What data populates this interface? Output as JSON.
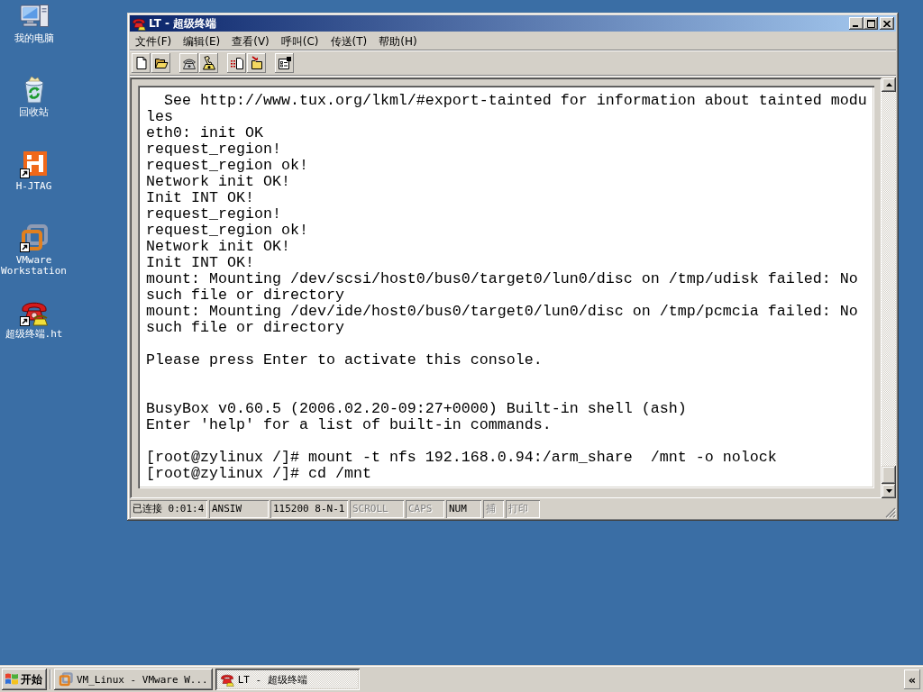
{
  "desktop": {
    "icons": [
      {
        "label": "我的电脑",
        "kind": "computer",
        "shortcut": false
      },
      {
        "label": "回收站",
        "kind": "recycle-bin",
        "shortcut": false
      },
      {
        "label": "H-JTAG",
        "kind": "h-jtag",
        "shortcut": true
      },
      {
        "label": "VMware Workstation",
        "kind": "vmware",
        "shortcut": true
      },
      {
        "label": "超级终端.ht",
        "kind": "phone",
        "shortcut": true
      }
    ]
  },
  "window": {
    "title": "LT - 超级终端",
    "active": true,
    "menu": [
      "文件(F)",
      "编辑(E)",
      "查看(V)",
      "呼叫(C)",
      "传送(T)",
      "帮助(H)"
    ],
    "toolbar": {
      "groups": [
        {
          "buttons": [
            {
              "kind": "new",
              "disabled": false
            },
            {
              "kind": "open",
              "disabled": false
            }
          ]
        },
        {
          "buttons": [
            {
              "kind": "call",
              "disabled": true
            },
            {
              "kind": "disconnect",
              "disabled": false
            }
          ]
        },
        {
          "buttons": [
            {
              "kind": "send",
              "disabled": false
            },
            {
              "kind": "receive",
              "disabled": false
            }
          ]
        },
        {
          "buttons": [
            {
              "kind": "properties",
              "disabled": false
            }
          ]
        }
      ]
    },
    "terminal": {
      "lines": [
        {
          "kind": "text",
          "text": "  See http://www.tux.org/lkml/#export-tainted for information about tainted modu"
        },
        {
          "kind": "text",
          "text": "les"
        },
        {
          "kind": "text",
          "text": "eth0: init OK"
        },
        {
          "kind": "text",
          "text": "request_region!"
        },
        {
          "kind": "text",
          "text": "request_region ok!"
        },
        {
          "kind": "text",
          "text": "Network init OK!"
        },
        {
          "kind": "text",
          "text": "Init INT OK!"
        },
        {
          "kind": "text",
          "text": "request_region!"
        },
        {
          "kind": "text",
          "text": "request_region ok!"
        },
        {
          "kind": "text",
          "text": "Network init OK!"
        },
        {
          "kind": "text",
          "text": "Init INT OK!"
        },
        {
          "kind": "text",
          "text": "mount: Mounting /dev/scsi/host0/bus0/target0/lun0/disc on /tmp/udisk failed: No"
        },
        {
          "kind": "text",
          "text": "such file or directory"
        },
        {
          "kind": "text",
          "text": "mount: Mounting /dev/ide/host0/bus0/target0/lun0/disc on /tmp/pcmcia failed: No"
        },
        {
          "kind": "text",
          "text": "such file or directory"
        },
        {
          "kind": "blank"
        },
        {
          "kind": "text",
          "text": "Please press Enter to activate this console."
        },
        {
          "kind": "blank"
        },
        {
          "kind": "blank"
        },
        {
          "kind": "text",
          "text": "BusyBox v0.60.5 (2006.02.20-09:27+0000) Built-in shell (ash)"
        },
        {
          "kind": "text",
          "text": "Enter 'help' for a list of built-in commands."
        },
        {
          "kind": "blank"
        },
        {
          "kind": "text",
          "text": "[root@zylinux /]# mount -t nfs 192.168.0.94:/arm_share  /mnt -o nolock"
        },
        {
          "kind": "text",
          "text": "[root@zylinux /]# cd /mnt"
        }
      ]
    },
    "status_bar": {
      "panels": [
        {
          "text": "已连接 0:01:4",
          "active": true
        },
        {
          "text": "ANSIW",
          "active": true
        },
        {
          "text": "115200 8-N-1",
          "active": true
        },
        {
          "text": "SCROLL",
          "active": false
        },
        {
          "text": "CAPS",
          "active": false
        },
        {
          "text": "NUM",
          "active": true
        },
        {
          "text": "捕",
          "active": false
        },
        {
          "text": "打印",
          "active": false
        }
      ]
    }
  },
  "taskbar": {
    "start": "开始",
    "tasks": [
      {
        "label": "VM_Linux - VMware W...",
        "kind": "vmware",
        "selected": false
      },
      {
        "label": "LT - 超级终端",
        "kind": "phone",
        "selected": true
      }
    ],
    "tray_toggle": "«"
  }
}
